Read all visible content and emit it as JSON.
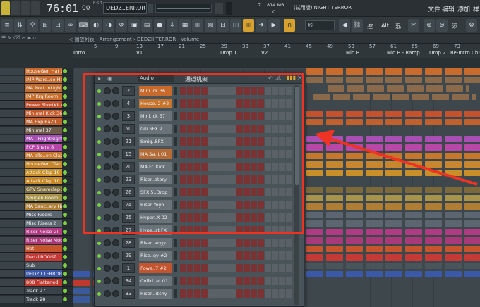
{
  "topbar": {
    "time": "76:01",
    "time_small": "00",
    "time_unit": "B:S:T",
    "pattern_label": "DEDZ..ERROR",
    "cpu_value": "7",
    "memory": "814 MB",
    "voices": "0",
    "hint_text": "(试用版) NIGHT TERROR",
    "menu": [
      "文件",
      "编辑",
      "添加",
      "样"
    ]
  },
  "toolbar": {
    "snap_value": "线",
    "right_labels": [
      "控",
      "Alt",
      "混",
      "添"
    ]
  },
  "breadcrumb": "◁ 播放列表 - Arrangement › DEDZII TERROR - Volume",
  "ruler": {
    "bar_numbers": [
      "5",
      "9",
      "13",
      "17",
      "21",
      "25",
      "29",
      "33",
      "37",
      "41",
      "45",
      "49",
      "53",
      "57",
      "61",
      "65",
      "69",
      "73"
    ],
    "markers": [
      "Intro",
      "V1",
      "Drop 1",
      "V2",
      "Mid B",
      "Mid B - Ramp",
      "Drop 2",
      "Re-Intro",
      "Chis"
    ]
  },
  "tracks": [
    {
      "name": "HouseGen Hat 02",
      "color": "#c8682a"
    },
    {
      "name": "IMP Ware..se Hall",
      "color": "#c26a2d"
    },
    {
      "name": "MA Nort..nLights",
      "color": "#bf6d31"
    },
    {
      "name": "IMP Krg Room",
      "color": "#c9702c"
    },
    {
      "name": "Power ShortKick",
      "color": "#c4522e"
    },
    {
      "name": "Minimal Kick 36",
      "color": "#c55a2b"
    },
    {
      "name": "MA Exp EaZII",
      "color": "#c0612d"
    },
    {
      "name": "Minimal 37",
      "color": "#6e5b4a"
    },
    {
      "name": "MA - FrightNight",
      "color": "#a94fb4"
    },
    {
      "name": "FCP Snare 8",
      "color": "#b847a8"
    },
    {
      "name": "MA allo..en Clap",
      "color": "#c7772c"
    },
    {
      "name": "HouseGen Clap 2",
      "color": "#c8862e"
    },
    {
      "name": "Attack Clap 10",
      "color": "#c9902a"
    },
    {
      "name": "Attack Clap 10",
      "color": "#c88a28"
    },
    {
      "name": "GRV Snareclap 25",
      "color": "#7c6a3c"
    },
    {
      "name": "Smigen Boom",
      "color": "#a8934a"
    },
    {
      "name": "MA Sanc..ary Hat",
      "color": "#b07d35"
    },
    {
      "name": "Misc Risers",
      "color": "#5b6670"
    },
    {
      "name": "Misc Risers 2",
      "color": "#5b6670"
    },
    {
      "name": "Riser Noise Gli",
      "color": "#b03b82"
    },
    {
      "name": "Riser Noise Mod",
      "color": "#a93a7a"
    },
    {
      "name": "Hat",
      "color": "#c6552e"
    },
    {
      "name": "DedziiBOOST",
      "color": "#c43a37"
    },
    {
      "name": "Sub",
      "color": "#4a545b"
    },
    {
      "name": "DEDZII TERROR",
      "color": "#3c58a8"
    },
    {
      "name": "808 Flattened",
      "color": "#c0392f"
    },
    {
      "name": "Track 27",
      "color": "#3a434a"
    },
    {
      "name": "Track 28",
      "color": "#3a434a"
    }
  ],
  "rack": {
    "title": "通道机架",
    "group": "Audio",
    "channels": [
      {
        "num": "2",
        "name": "Mini..ck 36",
        "color": "#c86a2c"
      },
      {
        "num": "4",
        "name": "House..2 #2",
        "color": "#c7742c"
      },
      {
        "num": "3",
        "name": "Mini..ck 37",
        "color": "#6a737a"
      },
      {
        "num": "50",
        "name": "Gili SFX 2",
        "color": "#6a737a"
      },
      {
        "num": "21",
        "name": "Smig..SFX",
        "color": "#6a737a"
      },
      {
        "num": "15",
        "name": "MA Sa..t 01",
        "color": "#b66a34"
      },
      {
        "num": "20",
        "name": "MA Fr..Kick",
        "color": "#6a737a"
      },
      {
        "num": "23",
        "name": "Riser..atory",
        "color": "#6a737a"
      },
      {
        "num": "26",
        "name": "SFX 5..Drop",
        "color": "#6a737a"
      },
      {
        "num": "24",
        "name": "Riser Yoyo",
        "color": "#6a737a"
      },
      {
        "num": "25",
        "name": "Hyper..X 02",
        "color": "#6a737a"
      },
      {
        "num": "27",
        "name": "Hype..st FX",
        "color": "#6a737a"
      },
      {
        "num": "28",
        "name": "Riser..angy",
        "color": "#6a737a"
      },
      {
        "num": "29",
        "name": "Rise..gy #2",
        "color": "#6a737a"
      },
      {
        "num": "1",
        "name": "Powe..7 #2",
        "color": "#c4542e"
      },
      {
        "num": "34",
        "name": "Collid..et 01",
        "color": "#6a737a"
      },
      {
        "num": "33",
        "name": "Riser..litchy",
        "color": "#6a737a"
      }
    ]
  },
  "clips_text": [
    "DE..ST",
    "Sub",
    "DE..OR",
    "Param",
    "Par..j #2",
    "Bu..se",
    "R..2",
    "DE..id"
  ]
}
